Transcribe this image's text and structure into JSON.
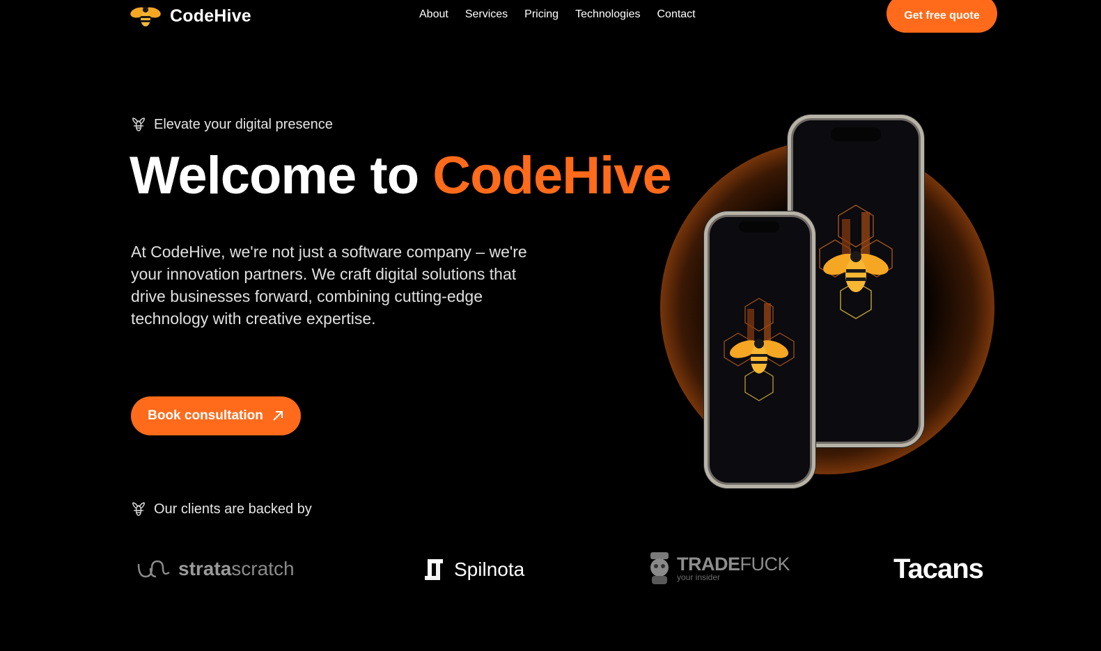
{
  "header": {
    "brand": "CodeHive",
    "nav": [
      {
        "label": "About"
      },
      {
        "label": "Services"
      },
      {
        "label": "Pricing"
      },
      {
        "label": "Technologies"
      },
      {
        "label": "Contact"
      }
    ],
    "cta_label": "Get free quote"
  },
  "hero": {
    "eyebrow": "Elevate your digital presence",
    "title_prefix": "Welcome to",
    "title_accent": "CodeHive",
    "description": "At CodeHive, we're not just a software company – we're your innovation partners. We craft digital solutions that drive businesses forward, combining cutting-edge technology with creative expertise.",
    "button_label": "Book consultation"
  },
  "clients": {
    "heading": "Our clients are backed by",
    "logos": [
      {
        "name_bold": "strata",
        "name_rest": "scratch"
      },
      {
        "name": "Spilnota"
      },
      {
        "name_bold": "TRADE",
        "name_rest": "FUCK",
        "tagline": "your insider"
      },
      {
        "name": "Tacans"
      }
    ]
  },
  "colors": {
    "accent": "#ff6b1a",
    "background": "#000000",
    "text": "#ffffff"
  }
}
